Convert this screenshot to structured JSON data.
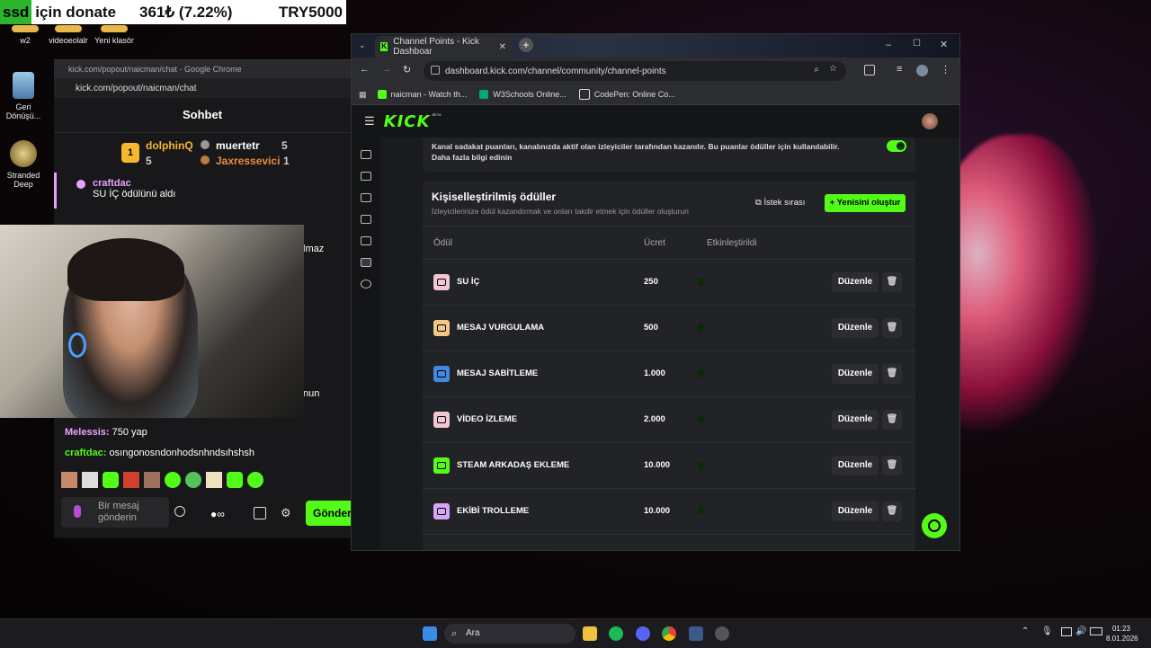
{
  "ticker": {
    "ssd": "ssd",
    "text1": "için donate",
    "amount": "361₺ (7.22%)",
    "total": "TRY5000"
  },
  "desktop": {
    "top_icons": [
      "w2",
      "videoeolalr",
      "Yeni klasör"
    ],
    "recycle_bin": "Geri Dönüşü...",
    "stranded_deep": "Stranded Deep"
  },
  "chat": {
    "window_title": "kick.com/popout/naicman/chat - Google Chrome",
    "url": "kick.com/popout/naicman/chat",
    "header": "Sohbet",
    "leaderboard": [
      {
        "rank": "1",
        "name": "dolphinQ",
        "points": "5"
      },
      {
        "rank": "2",
        "name": "muertetr",
        "points": "5"
      },
      {
        "rank": "3",
        "name": "Jaxressevici",
        "points": "1"
      }
    ],
    "redeem": {
      "user": "craftdac",
      "text": "SU İÇ ödülünü aldı"
    },
    "partial_lines": [
      "lmaz",
      "nun"
    ],
    "messages": [
      {
        "user": "Melessis:",
        "text": "750 yap"
      },
      {
        "user": "craftdac:",
        "text": "osıngonosndonhodsnhndsıhshsh"
      }
    ],
    "input_placeholder": "Bir mesaj gönderin",
    "send_label": "Gönder"
  },
  "browser": {
    "tab_title": "Channel Points - Kick Dashboar",
    "url": "dashboard.kick.com/channel/community/channel-points",
    "bookmarks": [
      "naicman - Watch th...",
      "W3Schools Online...",
      "CodePen: Online Co..."
    ],
    "logo": "KICK",
    "logo_beta": "BETA"
  },
  "loyalty": {
    "text": "Kanal sadakat puanları, kanalınızda aktif olan izleyiciler tarafından kazanılır. Bu puanlar ödüller için kullanılabilir.",
    "link": "Daha fazla bilgi edinin",
    "enabled": true
  },
  "rewards": {
    "title": "Kişiselleştirilmiş ödüller",
    "subtitle": "İzleyicilerinize ödül kazandırmak ve onları takdir etmek için ödüller oluşturun",
    "queue_button": "İstek sırası",
    "create_button": "Yenisini oluştur",
    "columns": {
      "reward": "Ödül",
      "cost": "Ücret",
      "enabled": "Etkinleştirildi"
    },
    "edit_label": "Düzenle",
    "items": [
      {
        "name": "SU İÇ",
        "cost": "250",
        "color": "#f3c6d2",
        "enabled": true
      },
      {
        "name": "MESAJ VURGULAMA",
        "cost": "500",
        "color": "#f5c784",
        "enabled": true
      },
      {
        "name": "MESAJ SABİTLEME",
        "cost": "1.000",
        "color": "#3f8ae0",
        "enabled": true
      },
      {
        "name": "VİDEO İZLEME",
        "cost": "2.000",
        "color": "#f3c6d2",
        "enabled": true
      },
      {
        "name": "STEAM ARKADAŞ EKLEME",
        "cost": "10.000",
        "color": "#53fc18",
        "enabled": true
      },
      {
        "name": "EKİBİ TROLLEME",
        "cost": "10.000",
        "color": "#d9a6f5",
        "enabled": true
      }
    ]
  },
  "taskbar": {
    "search": "Ara",
    "time": "01:23",
    "date": "8.01.2026"
  },
  "colors": {
    "accent": "#53fc18",
    "panel": "#222326",
    "page": "#1a1b1e"
  }
}
